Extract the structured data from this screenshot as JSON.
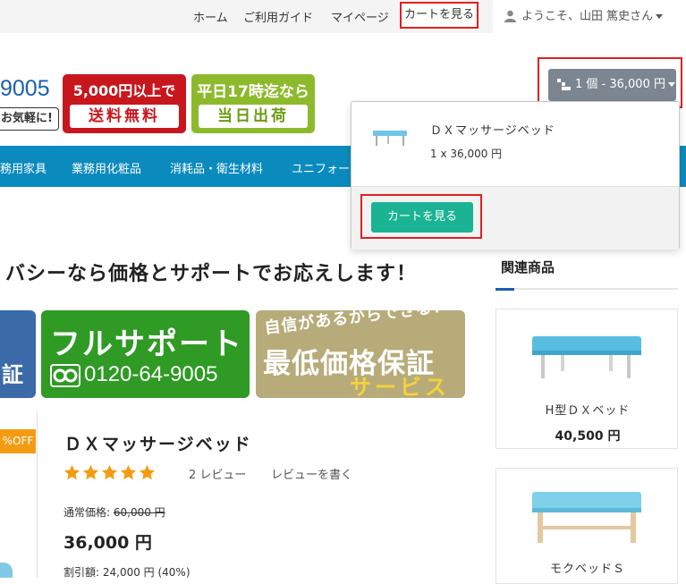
{
  "topbar": {
    "links": [
      "ホーム",
      "ご利用ガイド",
      "マイページ",
      "カートを見る"
    ],
    "user_greeting": "ようこそ、山田 篤史さん"
  },
  "header": {
    "phone_partial": "9005",
    "phone_sub": "お気軽に!",
    "badge_free_shipping": {
      "top": "5,000円以上で",
      "bottom": "送料無料"
    },
    "badge_same_day": {
      "top": "平日17時迄なら",
      "bottom": "当日出荷"
    }
  },
  "cart_button": {
    "label": "1 個 - 36,000 円"
  },
  "nav": {
    "items": [
      "務用家具",
      "業務用化粧品",
      "消耗品・衛生材料",
      "ユニフォー"
    ]
  },
  "cart_dropdown": {
    "item_name": "ＤＸマッサージベッド",
    "item_qty": "1 x 36,000 円",
    "view_cart_label": "カートを見る"
  },
  "headline": "バシーなら価格とサポートでお応えします！",
  "banners": {
    "blue_text": "証",
    "support_title": "フルサポート",
    "support_phone": "0120-64-9005",
    "guarantee_top": "自信があるからできる！",
    "guarantee_main": "最低価格保証",
    "guarantee_sub": "サービス"
  },
  "product": {
    "discount_tag": "%OFF",
    "title": "ＤＸマッサージベッド",
    "rating": 5,
    "reviews_label": "2 レビュー",
    "write_review_label": "レビューを書く",
    "regular_price_label": "通常価格:",
    "regular_price": "60,000 円",
    "price": "36,000 円",
    "discount_line": "割引額: 24,000 円 (40%)"
  },
  "related": {
    "title": "関連商品",
    "items": [
      {
        "name": "H型ＤＸベッド",
        "price": "40,500 円"
      },
      {
        "name": "モクベッドＳ",
        "price": ""
      }
    ]
  },
  "colors": {
    "nav_bg": "#0b8bbd",
    "cart_btn_bg": "#7b8691",
    "view_cart_bg": "#1ab394",
    "highlight_red": "#e02020",
    "offtag_bg": "#f39c12",
    "star": "#f39c12"
  }
}
